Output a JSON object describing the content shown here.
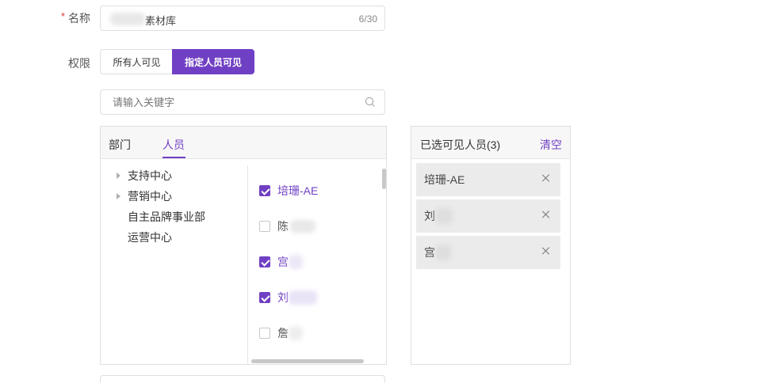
{
  "form": {
    "name_required_mark": "*",
    "name_label": "名称",
    "name_value": "素材库",
    "name_counter": "6/30",
    "permission_label": "权限",
    "permission_options": [
      "所有人可见",
      "指定人员可见"
    ],
    "permission_selected": "指定人员可见",
    "search_placeholder": "请输入关键字"
  },
  "picker": {
    "tabs": [
      "部门",
      "人员"
    ],
    "active_tab": "人员",
    "departments": [
      {
        "label": "支持中心",
        "expandable": true
      },
      {
        "label": "营销中心",
        "expandable": true
      },
      {
        "label": "自主品牌事业部",
        "expandable": false
      },
      {
        "label": "运营中心",
        "expandable": false
      }
    ],
    "people": [
      {
        "name": "培珊-AE",
        "checked": true
      },
      {
        "name": "陈",
        "checked": false
      },
      {
        "name": "宫",
        "checked": true
      },
      {
        "name": "刘",
        "checked": true
      },
      {
        "name": "詹",
        "checked": false
      }
    ]
  },
  "selected": {
    "title": "已选可见人员(3)",
    "clear_label": "清空",
    "items": [
      "培珊-AE",
      "刘",
      "宫"
    ]
  },
  "colors": {
    "accent": "#7040c4",
    "border": "#dcdfe6",
    "chip_bg": "#ebebeb"
  }
}
